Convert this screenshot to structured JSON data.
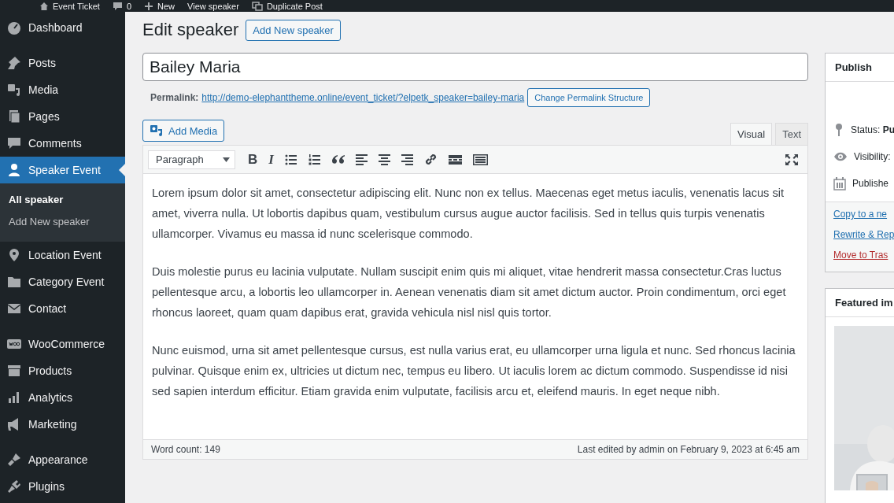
{
  "admin_bar": {
    "items": [
      "Event Ticket",
      "0",
      "New",
      "View speaker",
      "Duplicate Post"
    ]
  },
  "sidebar": {
    "groups": [
      [
        {
          "label": "Dashboard",
          "selected": false
        }
      ],
      [
        {
          "label": "Posts",
          "selected": false
        },
        {
          "label": "Media",
          "selected": false
        },
        {
          "label": "Pages",
          "selected": false
        },
        {
          "label": "Comments",
          "selected": false
        },
        {
          "label": "Speaker Event",
          "selected": true,
          "children": [
            {
              "label": "All speaker",
              "selected": true
            },
            {
              "label": "Add New speaker",
              "selected": false
            }
          ]
        },
        {
          "label": "Location Event",
          "selected": false
        },
        {
          "label": "Category Event",
          "selected": false
        },
        {
          "label": "Contact",
          "selected": false
        }
      ],
      [
        {
          "label": "WooCommerce",
          "selected": false
        },
        {
          "label": "Products",
          "selected": false
        },
        {
          "label": "Analytics",
          "selected": false
        },
        {
          "label": "Marketing",
          "selected": false
        }
      ],
      [
        {
          "label": "Appearance",
          "selected": false
        },
        {
          "label": "Plugins",
          "selected": false
        }
      ]
    ]
  },
  "page": {
    "title": "Edit speaker",
    "add_new_button": "Add New speaker"
  },
  "post_title": {
    "value": "Bailey Maria"
  },
  "permalink": {
    "label": "Permalink:",
    "url": "http://demo-elephanttheme.online/event_ticket/?elpetk_speaker=bailey-maria",
    "button": "Change Permalink Structure"
  },
  "editor": {
    "add_media_button": "Add Media",
    "tabs": [
      {
        "label": "Visual",
        "selected": true
      },
      {
        "label": "Text",
        "selected": false
      }
    ],
    "format_select": "Paragraph",
    "toolbar": [
      {
        "kind": "bold",
        "label": "B"
      },
      {
        "kind": "italic",
        "label": "I"
      },
      {
        "kind": "bullet-list"
      },
      {
        "kind": "numbered-list"
      },
      {
        "kind": "quote"
      },
      {
        "kind": "align-left"
      },
      {
        "kind": "align-center"
      },
      {
        "kind": "align-right"
      },
      {
        "kind": "link"
      },
      {
        "kind": "read-more"
      },
      {
        "kind": "toolbar-toggle"
      }
    ],
    "paragraphs": [
      "Lorem ipsum dolor sit amet, consectetur adipiscing elit. Nunc non ex tellus. Maecenas eget metus iaculis, venenatis lacus sit amet, viverra nulla. Ut lobortis dapibus quam, vestibulum cursus augue auctor facilisis. Sed in tellus quis turpis venenatis ullamcorper. Vivamus eu massa id nunc scelerisque commodo.",
      "Duis molestie purus eu lacinia vulputate. Nullam suscipit enim quis mi aliquet, vitae hendrerit massa consectetur.Cras luctus pellentesque arcu, a lobortis leo ullamcorper in. Aenean venenatis diam sit amet dictum auctor. Proin condimentum, orci eget rhoncus laoreet, quam quam dapibus erat, gravida vehicula nisl nisl quis tortor.",
      "Nunc euismod, urna sit amet pellentesque cursus, est nulla varius erat, eu ullamcorper urna ligula et nunc. Sed rhoncus lacinia pulvinar. Quisque enim ex, ultricies ut dictum nec, tempus eu libero. Ut iaculis lorem ac dictum commodo. Suspendisse id nisi sed sapien interdum efficitur. Etiam gravida enim vulputate, facilisis arcu et, eleifend mauris. In eget neque nibh."
    ],
    "word_count": "Word count: 149",
    "last_edited": "Last edited by admin on February 9, 2023 at 6:45 am"
  },
  "publish": {
    "title": "Publish",
    "rows": [
      "Status: **Pu**",
      "Visibility:",
      "Publishe"
    ],
    "links": [
      {
        "label": "Copy to a ne",
        "kind": "normal"
      },
      {
        "label": "Rewrite & Rep",
        "kind": "normal"
      },
      {
        "label": "Move to Tras",
        "kind": "danger"
      }
    ]
  },
  "featured_image": {
    "title": "Featured im",
    "kind": "picture"
  }
}
